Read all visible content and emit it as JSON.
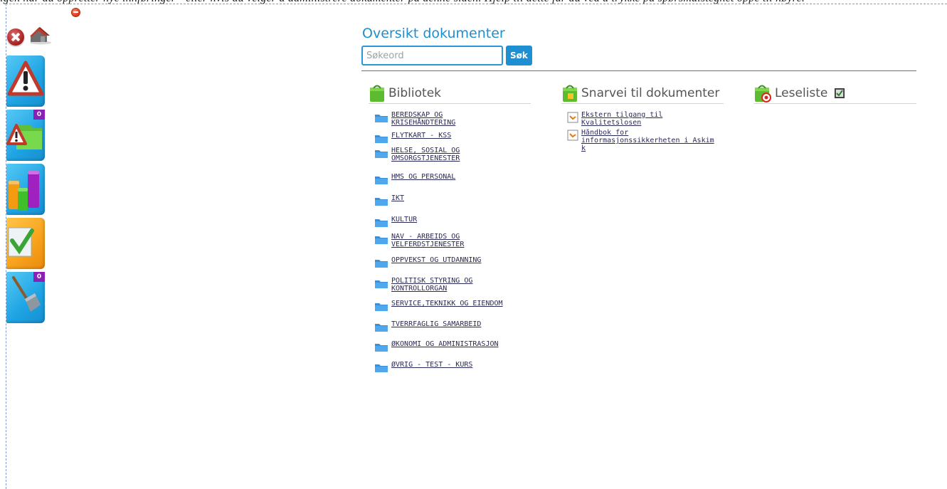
{
  "top_text": "igen når du oppretter nye innføringer - eller hvis du velger å administrere dokumenter på denne siden. Hjelp til dette får du ved å trykke på spørsmålstegnet oppe til høyre.",
  "main": {
    "title": "Oversikt dokumenter",
    "search": {
      "placeholder": "Søkeord",
      "button_label": "Søk"
    }
  },
  "sidebar": {
    "items": [
      {
        "name": "warning",
        "badge": null
      },
      {
        "name": "deviation-folder",
        "badge": "0"
      },
      {
        "name": "statistics",
        "badge": null
      },
      {
        "name": "checklist",
        "badge": null
      },
      {
        "name": "tools",
        "badge": "0"
      }
    ]
  },
  "library": {
    "title": "Bibliotek",
    "items": [
      "BEREDSKAP OG KRISEHÅNDTERING",
      "FLYTKART - KSS",
      "HELSE, SOSIAL OG OMSORGSTJENESTER",
      "HMS OG PERSONAL",
      "IKT",
      "KULTUR",
      "NAV - ARBEIDS OG VELFERDSTJENESTER",
      "OPPVEKST OG UTDANNING",
      "POLITISK STYRING OG KONTROLLORGAN",
      "SERVICE,TEKNIKK OG EIENDOM",
      "TVERRFAGLIG SAMARBEID",
      "ØKONOMI OG ADMINISTRASJON",
      "ØVRIG - TEST - KURS"
    ]
  },
  "shortcuts": {
    "title": "Snarvei til dokumenter",
    "items": [
      "Ekstern tilgang til Kvalitetslosen",
      "Håndbok for informasjonssikkerheten i Askim k"
    ]
  },
  "reading_list": {
    "title": "Leseliste"
  },
  "colors": {
    "accent": "#1d8fd0",
    "tile_blue": "#1ea3e3",
    "tile_orange": "#f7a21b",
    "badge": "#8b1fb7",
    "rule_green": "#2ca02c"
  }
}
